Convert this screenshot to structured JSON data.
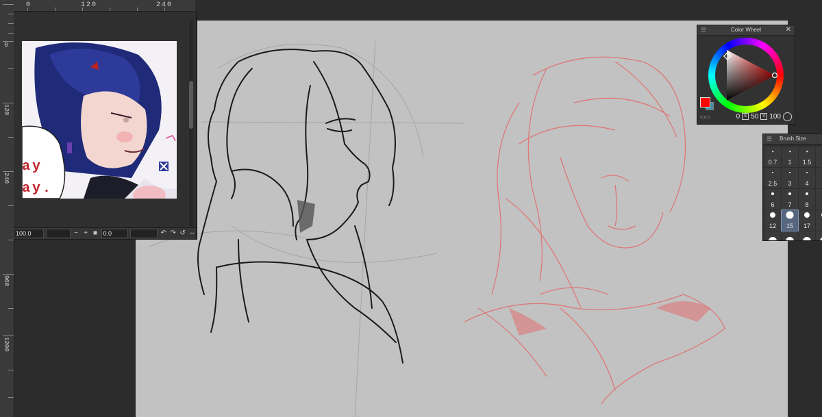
{
  "rulers": {
    "vertical_labels": [
      "0",
      "120",
      "240",
      "960",
      "1200"
    ],
    "horizontal_labels": [
      "0",
      "120",
      "240"
    ]
  },
  "navigator": {
    "preview_text": [
      "ay",
      "ay."
    ],
    "zoom_value": "100.0",
    "rotation_value": "0.0",
    "zoom_out_glyph": "−",
    "zoom_in_glyph": "+"
  },
  "color_wheel": {
    "title": "Color Wheel",
    "main_color": "#ff0000",
    "sub_color": "#3c8ea0",
    "values": [
      "0",
      "50",
      "100"
    ]
  },
  "brush_size": {
    "title": "Brush Size",
    "sizes": [
      "0.7",
      "1",
      "1.5",
      "",
      "2.5",
      "3",
      "4",
      "",
      "6",
      "7",
      "8",
      "",
      "12",
      "15",
      "17",
      "",
      "",
      "",
      "",
      ""
    ],
    "selected": "15"
  },
  "canvas": {
    "background": "#c2c2c2",
    "lineart_color": "#1a1a1a",
    "sketch_color": "#e07070"
  }
}
